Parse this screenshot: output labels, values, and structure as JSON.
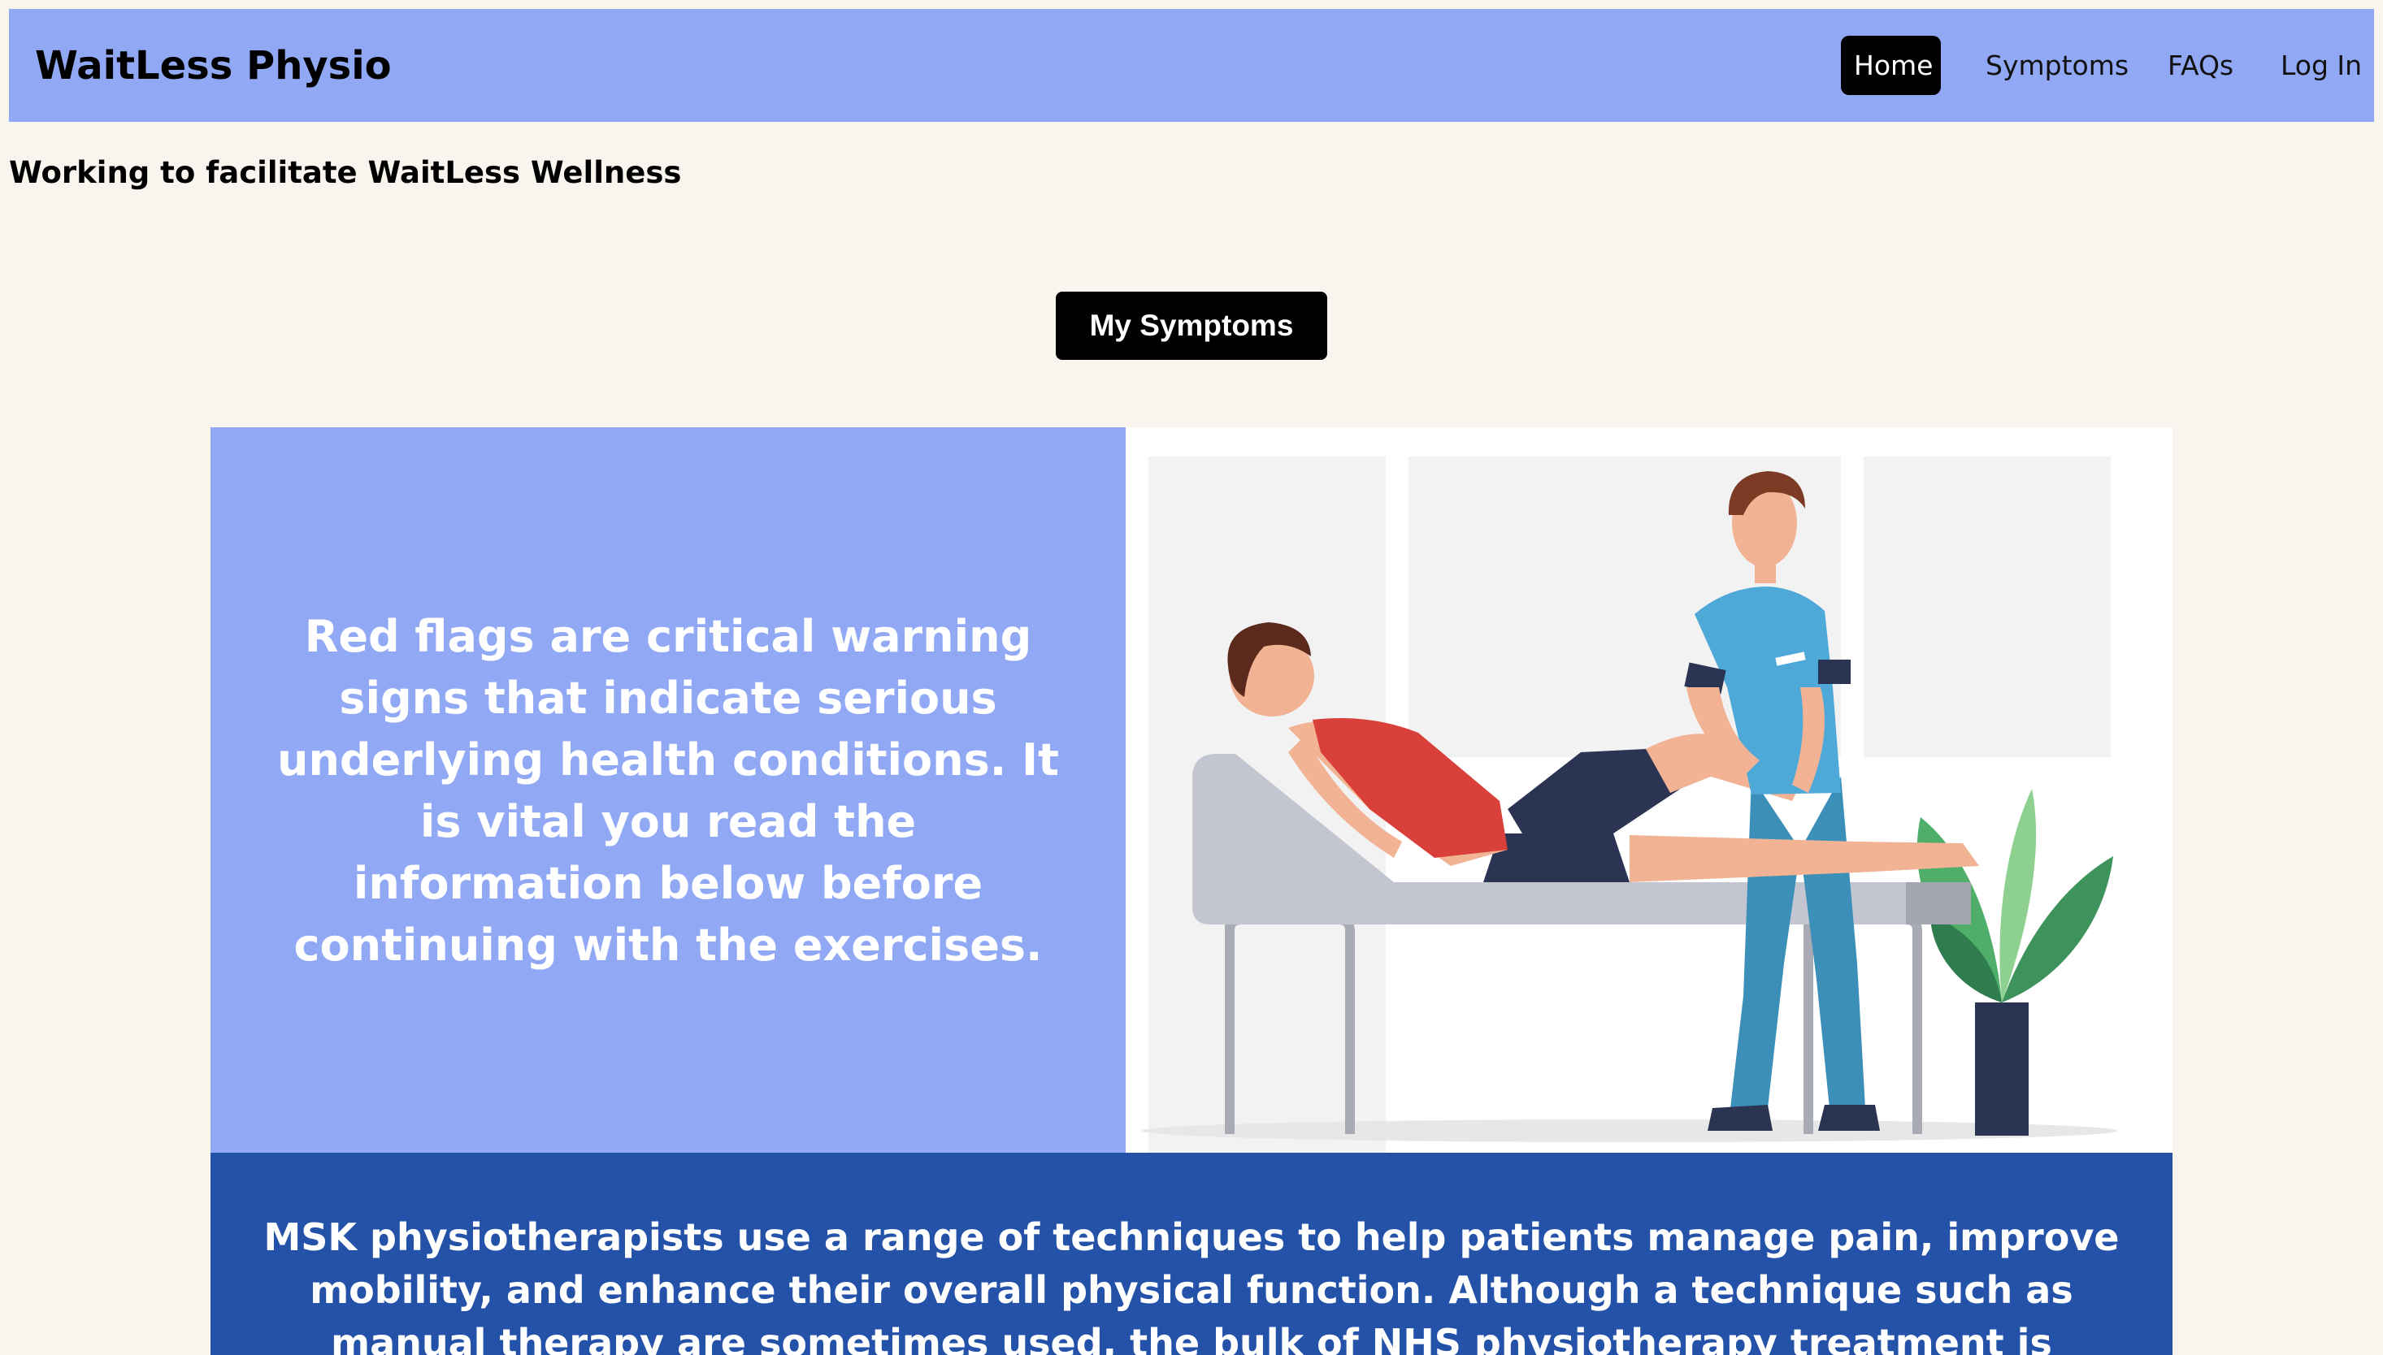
{
  "header": {
    "brand": "WaitLess Physio",
    "nav": [
      {
        "label": "Home",
        "active": true
      },
      {
        "label": "Symptoms",
        "active": false
      },
      {
        "label": "FAQs",
        "active": false
      },
      {
        "label": "Log In",
        "active": false
      }
    ]
  },
  "tagline": "Working to facilitate WaitLess Wellness",
  "cta": {
    "label": "My Symptoms"
  },
  "red_flags": {
    "text": "Red flags are critical warning signs that indicate serious underlying health conditions. It is vital you read the information below before continuing with the exercises."
  },
  "msk": {
    "text": "MSK physiotherapists use a range of techniques to help patients manage pain, improve mobility, and enhance their overall physical function. Although a technique such as manual therapy are sometimes used, the bulk of NHS physiotherapy treatment is exercises, education, and advice."
  },
  "illustration": {
    "subject": "physiotherapist-treating-patient-illustration"
  },
  "colors": {
    "page_background": "#f9f4ee",
    "header_background": "#91a9f4",
    "active_nav_background": "#000000",
    "info_panel": "#91a9f4",
    "band": "#2352a8"
  }
}
